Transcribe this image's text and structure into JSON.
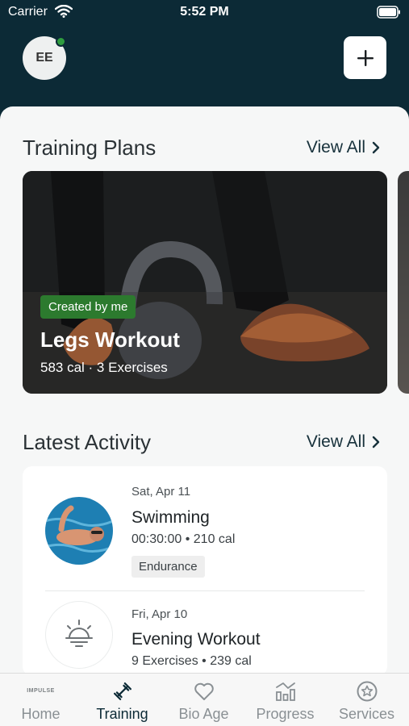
{
  "status_bar": {
    "carrier": "Carrier",
    "time": "5:52 PM"
  },
  "header": {
    "avatar_initials": "EE"
  },
  "training_plans": {
    "title": "Training Plans",
    "view_all": "View All",
    "cards": [
      {
        "badge": "Created by me",
        "name": "Legs Workout",
        "meta": "583 cal · 3 Exercises"
      }
    ]
  },
  "latest_activity": {
    "title": "Latest Activity",
    "view_all": "View All",
    "items": [
      {
        "date": "Sat, Apr 11",
        "name": "Swimming",
        "meta": "00:30:00 • 210 cal",
        "tag": "Endurance"
      },
      {
        "date": "Fri, Apr 10",
        "name": "Evening Workout",
        "meta": "9 Exercises • 239 cal"
      }
    ]
  },
  "tab_bar": {
    "tabs": [
      {
        "label": "Home",
        "logo_text": "IMPULSE",
        "icon": "impulse-logo",
        "active": false
      },
      {
        "label": "Training",
        "icon": "dumbbell-icon",
        "active": true
      },
      {
        "label": "Bio Age",
        "icon": "heart-icon",
        "active": false
      },
      {
        "label": "Progress",
        "icon": "bar-chart-icon",
        "active": false
      },
      {
        "label": "Services",
        "icon": "star-badge-icon",
        "active": false
      }
    ]
  },
  "colors": {
    "header_bg": "#0c2a36",
    "badge_green": "#2c7a2e",
    "online_dot": "#2f9d3f",
    "active_tab": "#0c2a36",
    "inactive_tab": "#8a9094"
  }
}
